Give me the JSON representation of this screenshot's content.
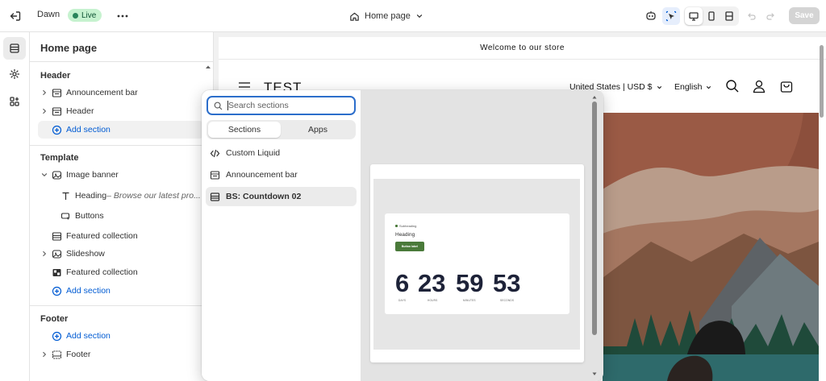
{
  "topbar": {
    "theme_name": "Dawn",
    "live_badge": "Live",
    "page_selector": "Home page",
    "save_label": "Save",
    "icons": [
      "exit-icon",
      "more-icon",
      "home-icon",
      "chevron-down-icon",
      "ai-icon",
      "inspector-icon",
      "desktop-icon",
      "mobile-icon",
      "fullscreen-icon",
      "undo-icon",
      "redo-icon"
    ]
  },
  "rail": {
    "icons": [
      "sections-icon",
      "theme-settings-icon",
      "app-embeds-icon"
    ]
  },
  "sidebar": {
    "title": "Home page",
    "header_group": {
      "title": "Header",
      "items": [
        "Announcement bar",
        "Header"
      ],
      "add_label": "Add section"
    },
    "template_group": {
      "title": "Template",
      "image_banner": "Image banner",
      "heading_label": "Heading",
      "heading_detail": " – Browse our latest pro...",
      "buttons_label": "Buttons",
      "items": [
        "Featured collection",
        "Slideshow",
        "Featured collection"
      ],
      "add_label": "Add section"
    },
    "footer_group": {
      "title": "Footer",
      "add_label": "Add section",
      "items": [
        "Footer"
      ]
    }
  },
  "preview": {
    "announcement": "Welcome to our store",
    "logo": "TEST",
    "locale": "United States | USD $",
    "language": "English",
    "colors": {
      "banner_sky": "#8c4f3c",
      "banner_mountain": "#6e7a7e",
      "banner_forest": "#1f4a3a"
    }
  },
  "picker": {
    "search_placeholder": "Search sections",
    "search_value": "",
    "tabs": [
      "Sections",
      "Apps"
    ],
    "items": [
      {
        "label": "Custom Liquid",
        "icon": "code-icon"
      },
      {
        "label": "Announcement bar",
        "icon": "announcement-icon"
      },
      {
        "label": "BS: Countdown 02",
        "icon": "section-icon"
      }
    ],
    "preview": {
      "subheading": "Subheading",
      "heading": "Heading",
      "button_label": "Button label",
      "days": "6",
      "hours": "23",
      "minutes": "59",
      "seconds": "53",
      "units": [
        "DAYS",
        "HOURS",
        "MINUTES",
        "SECONDS"
      ]
    }
  },
  "colors": {
    "accent": "#005bd3",
    "live_bg": "#c6f2cf",
    "live_dot": "#29845a",
    "focus": "#2c6ecb",
    "countdown_text": "#1d2238",
    "countdown_button": "#4a7a3a"
  }
}
